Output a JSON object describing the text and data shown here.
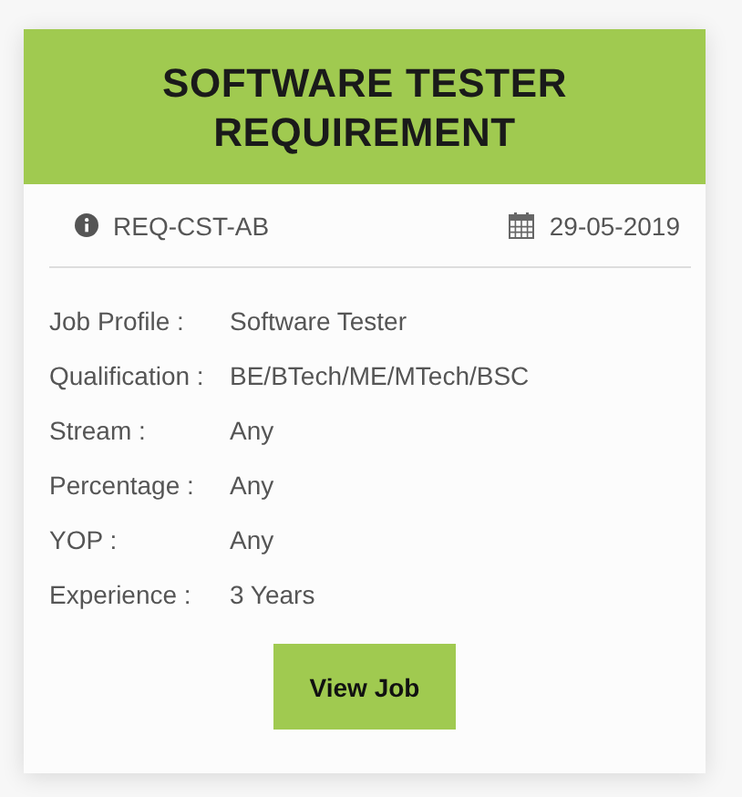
{
  "card": {
    "title": "SOFTWARE TESTER REQUIREMENT",
    "reference": "REQ-CST-AB",
    "date": "29-05-2019",
    "details": [
      {
        "label": "Job Profile :",
        "value": "Software Tester"
      },
      {
        "label": "Qualification :",
        "value": "BE/BTech/ME/MTech/BSC"
      },
      {
        "label": "Stream :",
        "value": "Any"
      },
      {
        "label": "Percentage :",
        "value": "Any"
      },
      {
        "label": "YOP :",
        "value": "Any"
      },
      {
        "label": "Experience :",
        "value": "3 Years"
      }
    ],
    "button": "View Job"
  }
}
